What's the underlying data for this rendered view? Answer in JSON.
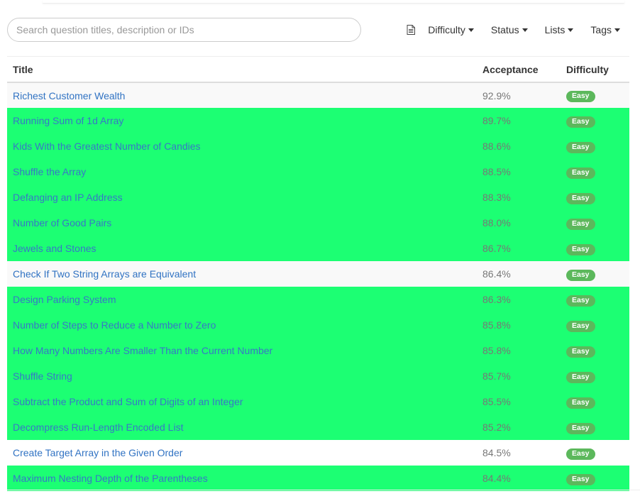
{
  "search": {
    "placeholder": "Search question titles, description or IDs"
  },
  "filters": [
    {
      "label": "Difficulty"
    },
    {
      "label": "Status"
    },
    {
      "label": "Lists"
    },
    {
      "label": "Tags"
    }
  ],
  "table": {
    "headers": {
      "title": "Title",
      "acceptance": "Acceptance",
      "difficulty": "Difficulty"
    },
    "rows": [
      {
        "title": "Richest Customer Wealth",
        "acceptance": "92.9%",
        "difficulty": "Easy",
        "style": "striped"
      },
      {
        "title": "Running Sum of 1d Array",
        "acceptance": "89.7%",
        "difficulty": "Easy",
        "style": "highlight"
      },
      {
        "title": "Kids With the Greatest Number of Candies",
        "acceptance": "88.6%",
        "difficulty": "Easy",
        "style": "highlight"
      },
      {
        "title": "Shuffle the Array",
        "acceptance": "88.5%",
        "difficulty": "Easy",
        "style": "highlight"
      },
      {
        "title": "Defanging an IP Address",
        "acceptance": "88.3%",
        "difficulty": "Easy",
        "style": "highlight"
      },
      {
        "title": "Number of Good Pairs",
        "acceptance": "88.0%",
        "difficulty": "Easy",
        "style": "highlight"
      },
      {
        "title": "Jewels and Stones",
        "acceptance": "86.7%",
        "difficulty": "Easy",
        "style": "highlight"
      },
      {
        "title": "Check If Two String Arrays are Equivalent",
        "acceptance": "86.4%",
        "difficulty": "Easy",
        "style": "striped"
      },
      {
        "title": "Design Parking System",
        "acceptance": "86.3%",
        "difficulty": "Easy",
        "style": "highlight"
      },
      {
        "title": "Number of Steps to Reduce a Number to Zero",
        "acceptance": "85.8%",
        "difficulty": "Easy",
        "style": "highlight"
      },
      {
        "title": "How Many Numbers Are Smaller Than the Current Number",
        "acceptance": "85.8%",
        "difficulty": "Easy",
        "style": "highlight"
      },
      {
        "title": "Shuffle String",
        "acceptance": "85.7%",
        "difficulty": "Easy",
        "style": "highlight"
      },
      {
        "title": "Subtract the Product and Sum of Digits of an Integer",
        "acceptance": "85.5%",
        "difficulty": "Easy",
        "style": "highlight"
      },
      {
        "title": "Decompress Run-Length Encoded List",
        "acceptance": "85.2%",
        "difficulty": "Easy",
        "style": "highlight"
      },
      {
        "title": "Create Target Array in the Given Order",
        "acceptance": "84.5%",
        "difficulty": "Easy",
        "style": "plain"
      },
      {
        "title": "Maximum Nesting Depth of the Parentheses",
        "acceptance": "84.4%",
        "difficulty": "Easy",
        "style": "highlight"
      }
    ]
  },
  "colors": {
    "highlight_row": "#1cff73",
    "link": "#3173c3",
    "easy_badge": "#5cb85c"
  },
  "icons": {
    "layout_toggle": "document-icon",
    "dropdown": "caret-down-icon"
  }
}
